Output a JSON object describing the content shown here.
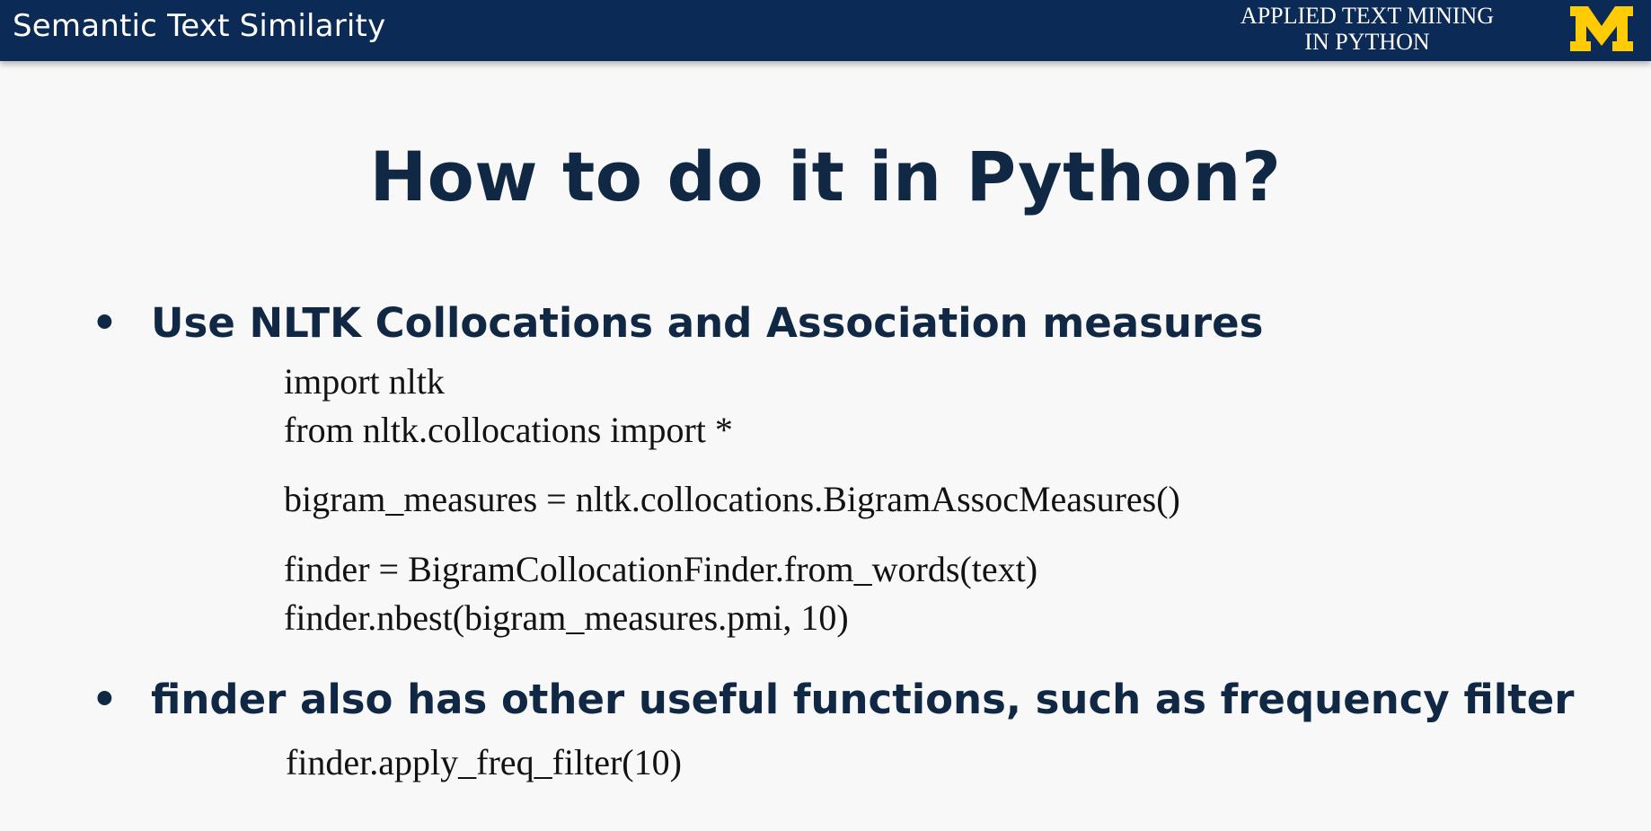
{
  "header": {
    "section_title": "Semantic Text Similarity",
    "course_line1": "APPLIED TEXT MINING",
    "course_line2": "IN PYTHON",
    "logo_icon": "block-m-logo",
    "bar_color": "#0b2a55",
    "logo_color": "#ffcb05"
  },
  "slide": {
    "title": "How to do it in Python?",
    "bullets": [
      {
        "symbol": "•",
        "text": "Use NLTK Collocations and Association measures",
        "code": [
          "import nltk",
          "from nltk.collocations import *",
          "bigram_measures = nltk.collocations.BigramAssocMeasures()",
          "finder = BigramCollocationFinder.from_words(text)",
          "finder.nbest(bigram_measures.pmi, 10)"
        ]
      },
      {
        "symbol": "•",
        "text": "finder also has other useful functions, such as frequency filter",
        "code": [
          "finder.apply_freq_filter(10)"
        ]
      }
    ]
  }
}
